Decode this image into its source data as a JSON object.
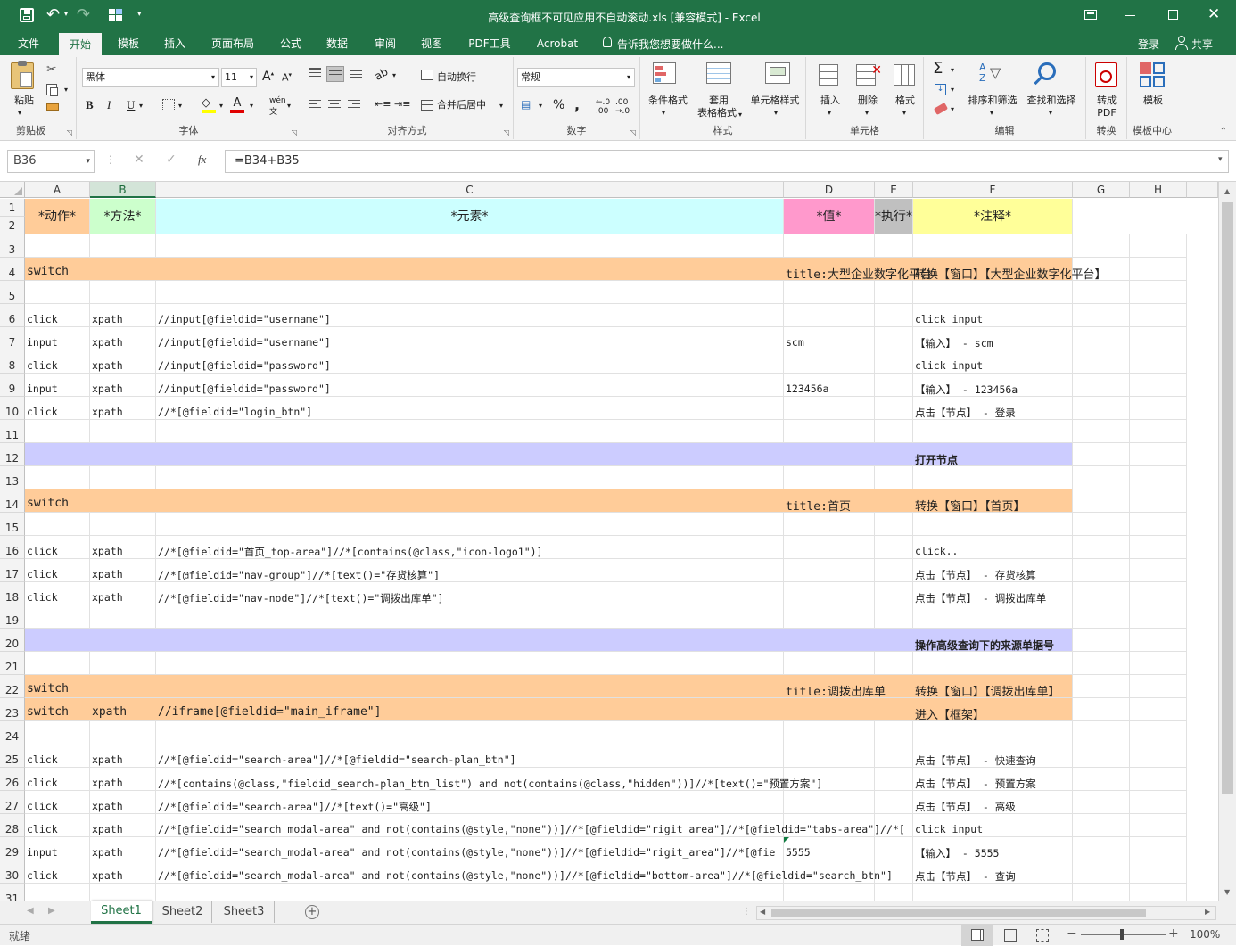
{
  "window": {
    "title": "高级查询框不可见应用不自动滚动.xls  [兼容模式] - Excel",
    "colors": {
      "brand": "#217346"
    }
  },
  "qat": {
    "save_icon": "save-icon",
    "undo_icon": "undo-icon",
    "redo_icon": "redo-icon"
  },
  "menu": {
    "tabs": [
      "文件",
      "开始",
      "模板",
      "插入",
      "页面布局",
      "公式",
      "数据",
      "审阅",
      "视图",
      "PDF工具",
      "Acrobat"
    ],
    "active": "开始",
    "tell_me": "告诉我您想要做什么...",
    "login": "登录",
    "share": "共享"
  },
  "ribbon": {
    "clipboard": {
      "paste": "粘贴",
      "label": "剪贴板"
    },
    "font": {
      "name": "黑体",
      "size": "11",
      "label": "字体",
      "bold": "B",
      "italic": "I",
      "underline": "U"
    },
    "alignment": {
      "wrap": "自动换行",
      "merge": "合并后居中",
      "label": "对齐方式"
    },
    "number": {
      "format": "常规",
      "percent": "%",
      "comma": ",",
      "label": "数字"
    },
    "styles": {
      "conditional": "条件格式",
      "table_line1": "套用",
      "table_line2": "表格格式",
      "cell_styles": "单元格样式",
      "label": "样式"
    },
    "cells": {
      "insert": "插入",
      "delete": "删除",
      "format": "格式",
      "label": "单元格"
    },
    "editing": {
      "sort": "排序和筛选",
      "find": "查找和选择",
      "label": "编辑"
    },
    "convert": {
      "pdf_line1": "转成",
      "pdf_line2": "PDF",
      "label": "转换"
    },
    "template": {
      "btn": "模板",
      "label": "模板中心"
    }
  },
  "formula_bar": {
    "name_box": "B36",
    "fx": "fx",
    "formula": "=B34+B35"
  },
  "columns": [
    "A",
    "B",
    "C",
    "D",
    "E",
    "F",
    "G",
    "H"
  ],
  "rows": [
    {
      "num": "1",
      "cells": {}
    },
    {
      "num": "2",
      "cells": {}
    },
    {
      "num": "3",
      "cells": {}
    },
    {
      "num": "4",
      "cells": {
        "A": "switch",
        "D": "title:大型企业数字化平台",
        "F": "转换【窗口】【大型企业数字化平台】"
      }
    },
    {
      "num": "5",
      "cells": {}
    },
    {
      "num": "6",
      "cells": {
        "A": "click",
        "B": "xpath",
        "C": "//input[@fieldid=\"username\"]",
        "F": "click input"
      }
    },
    {
      "num": "7",
      "cells": {
        "A": "input",
        "B": "xpath",
        "C": "//input[@fieldid=\"username\"]",
        "D": "scm",
        "F": "【输入】 - scm"
      }
    },
    {
      "num": "8",
      "cells": {
        "A": "click",
        "B": "xpath",
        "C": "//input[@fieldid=\"password\"]",
        "F": "click input"
      }
    },
    {
      "num": "9",
      "cells": {
        "A": "input",
        "B": "xpath",
        "C": "//input[@fieldid=\"password\"]",
        "D": "123456a",
        "F": "【输入】 - 123456a"
      }
    },
    {
      "num": "10",
      "cells": {
        "A": "click",
        "B": "xpath",
        "C": "//*[@fieldid=\"login_btn\"]",
        "F": "点击【节点】 - 登录"
      }
    },
    {
      "num": "11",
      "cells": {}
    },
    {
      "num": "12",
      "cells": {
        "F": "打开节点"
      }
    },
    {
      "num": "13",
      "cells": {}
    },
    {
      "num": "14",
      "cells": {
        "A": "switch",
        "D": "title:首页",
        "F": "转换【窗口】【首页】"
      }
    },
    {
      "num": "15",
      "cells": {}
    },
    {
      "num": "16",
      "cells": {
        "A": "click",
        "B": "xpath",
        "C": "//*[@fieldid=\"首页_top-area\"]//*[contains(@class,\"icon-logo1\")]",
        "F": "click.."
      }
    },
    {
      "num": "17",
      "cells": {
        "A": "click",
        "B": "xpath",
        "C": "//*[@fieldid=\"nav-group\"]//*[text()=\"存货核算\"]",
        "F": "点击【节点】 - 存货核算"
      }
    },
    {
      "num": "18",
      "cells": {
        "A": "click",
        "B": "xpath",
        "C": "//*[@fieldid=\"nav-node\"]//*[text()=\"调拨出库单\"]",
        "F": "点击【节点】 - 调拨出库单"
      }
    },
    {
      "num": "19",
      "cells": {}
    },
    {
      "num": "20",
      "cells": {
        "F": "操作高级查询下的来源单据号"
      }
    },
    {
      "num": "21",
      "cells": {}
    },
    {
      "num": "22",
      "cells": {
        "A": "switch",
        "D": "title:调拨出库单",
        "F": "转换【窗口】【调拨出库单】"
      }
    },
    {
      "num": "23",
      "cells": {
        "A": "switch",
        "B": "xpath",
        "C": "//iframe[@fieldid=\"main_iframe\"]",
        "F": "进入【框架】"
      }
    },
    {
      "num": "24",
      "cells": {}
    },
    {
      "num": "25",
      "cells": {
        "A": "click",
        "B": "xpath",
        "C": "//*[@fieldid=\"search-area\"]//*[@fieldid=\"search-plan_btn\"]",
        "F": "点击【节点】 - 快速查询"
      }
    },
    {
      "num": "26",
      "cells": {
        "A": "click",
        "B": "xpath",
        "C": "//*[contains(@class,\"fieldid_search-plan_btn_list\") and not(contains(@class,\"hidden\"))]//*[text()=\"预置方案\"]",
        "F": "点击【节点】 - 预置方案"
      }
    },
    {
      "num": "27",
      "cells": {
        "A": "click",
        "B": "xpath",
        "C": "//*[@fieldid=\"search-area\"]//*[text()=\"高级\"]",
        "F": "点击【节点】 - 高级"
      }
    },
    {
      "num": "28",
      "cells": {
        "A": "click",
        "B": "xpath",
        "C": "//*[@fieldid=\"search_modal-area\" and not(contains(@style,\"none\"))]//*[@fieldid=\"rigit_area\"]//*[@fieldid=\"tabs-area\"]//*[",
        "F": "click input"
      }
    },
    {
      "num": "29",
      "cells": {
        "A": "input",
        "B": "xpath",
        "C": "//*[@fieldid=\"search_modal-area\" and not(contains(@style,\"none\"))]//*[@fieldid=\"rigit_area\"]//*[@fie",
        "D": "5555",
        "F": "【输入】 - 5555"
      }
    },
    {
      "num": "30",
      "cells": {
        "A": "click",
        "B": "xpath",
        "C": "//*[@fieldid=\"search_modal-area\" and not(contains(@style,\"none\"))]//*[@fieldid=\"bottom-area\"]//*[@fieldid=\"search_btn\"]",
        "F": "点击【节点】 - 查询"
      }
    },
    {
      "num": "31",
      "cells": {}
    }
  ],
  "header_labels": {
    "A": "*动作*",
    "B": "*方法*",
    "C": "*元素*",
    "D": "*值*",
    "E": "*执行*",
    "F": "*注释*"
  },
  "sheets": [
    "Sheet1",
    "Sheet2",
    "Sheet3"
  ],
  "active_sheet": "Sheet1",
  "status": {
    "ready": "就绪",
    "zoom": "100%"
  }
}
